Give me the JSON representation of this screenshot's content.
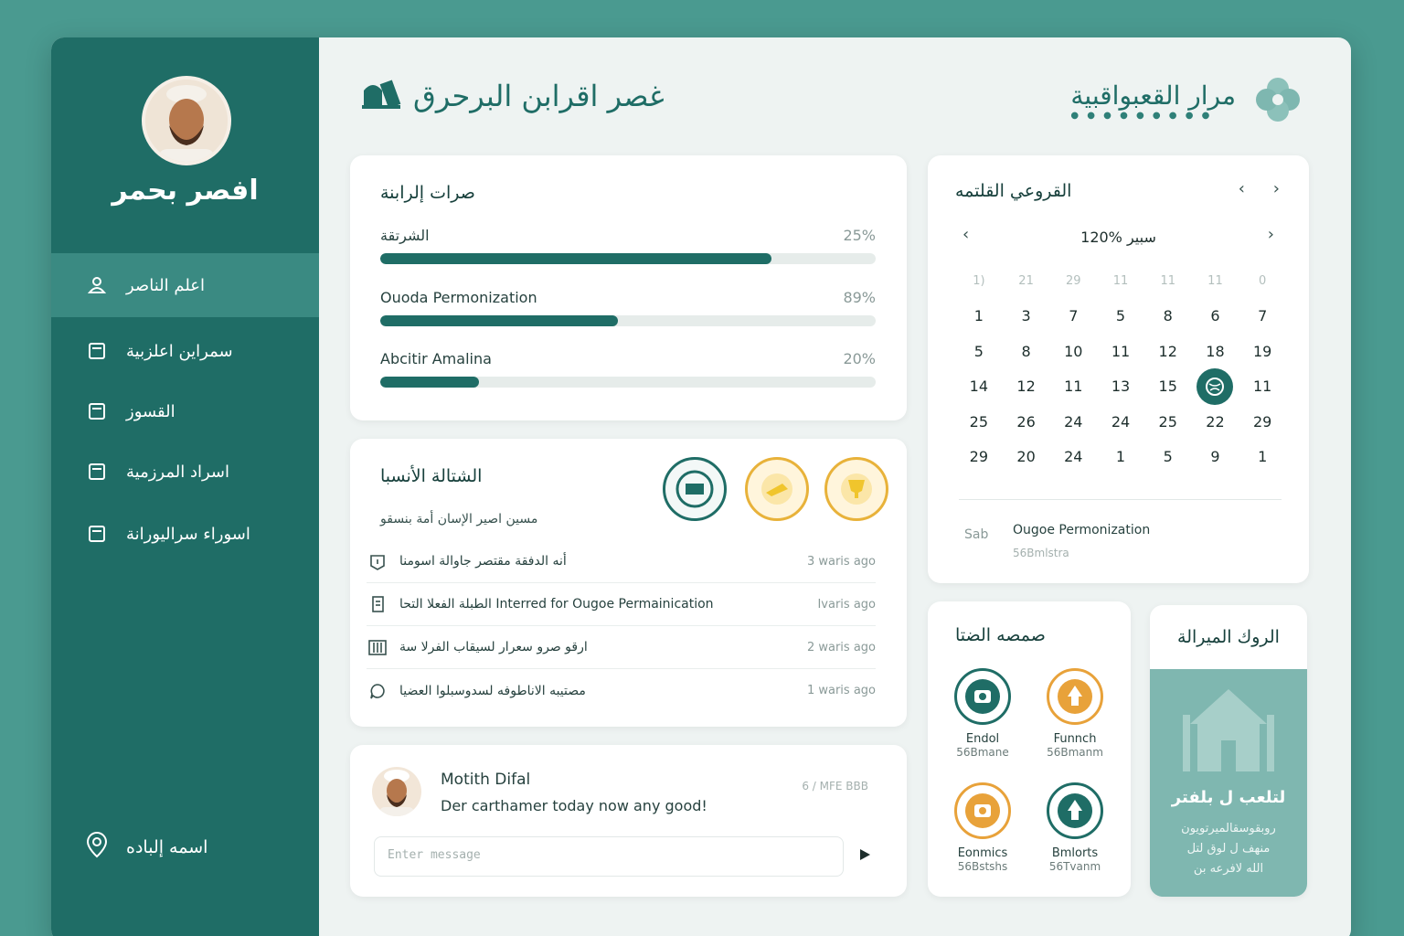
{
  "sidebar": {
    "user_name": "افصر بحمر",
    "items": [
      {
        "label": "اعلم الناصر",
        "icon": "user-icon"
      },
      {
        "label": "سمراين اعلزبية",
        "icon": "document-icon"
      },
      {
        "label": "القسوز",
        "icon": "document-icon"
      },
      {
        "label": "اسراد المرزمية",
        "icon": "document-icon"
      },
      {
        "label": "اسوراء سراليورانة",
        "icon": "document-icon"
      }
    ],
    "location_label": "اسمه إلباده"
  },
  "header": {
    "title": "غصر اقرابن البرحرق",
    "brand": "مرار القعبواقبية"
  },
  "progress_card": {
    "title": "صرات إلرابنة",
    "items": [
      {
        "label": "الشرتقة",
        "pct_label": "25%",
        "fill": 0.79
      },
      {
        "label": "Ouoda Permonization",
        "pct_label": "89%",
        "fill": 0.48
      },
      {
        "label": "Abcitir Amalina",
        "pct_label": "20%",
        "fill": 0.2
      }
    ]
  },
  "activity_card": {
    "title": "الشتالة الأنسبا",
    "subtitle": "مسين اصير الإسان أمة بنسقو",
    "rows": [
      {
        "text": "أنه الدفقة مقتصر جاوالة اسومنا",
        "time": "3 waris ago",
        "icon": "alert-icon"
      },
      {
        "text": "الطبلة الفعلا التحا Interred for Ougoe Permainication",
        "time": "Ivaris ago",
        "icon": "doc-icon"
      },
      {
        "text": "ارقو صرو سعرار لسيقاب الفرلا سة",
        "time": "2 waris ago",
        "icon": "building-icon"
      },
      {
        "text": "مصتيبه الاناطوفه لسدوسبلوا العضيا",
        "time": "1 waris ago",
        "icon": "chat-icon"
      }
    ]
  },
  "message_card": {
    "sender": "Motith Difal",
    "text": "Der carthamer today now any good!",
    "time": "6 / MFE BBB",
    "placeholder": "Enter message"
  },
  "calendar": {
    "title": "القروعي القلتمه",
    "month_label": "120% سبير",
    "weekdays": [
      "1)",
      "21",
      "29",
      "11",
      "11",
      "11",
      "0"
    ],
    "weeks": [
      [
        "1",
        "3",
        "7",
        "5",
        "8",
        "6",
        "7"
      ],
      [
        "5",
        "8",
        "10",
        "11",
        "12",
        "18",
        "19"
      ],
      [
        "14",
        "12",
        "11",
        "13",
        "15",
        "",
        "11"
      ],
      [
        "25",
        "26",
        "24",
        "24",
        "25",
        "22",
        "29"
      ],
      [
        "29",
        "20",
        "24",
        "1",
        "5",
        "9",
        "1"
      ]
    ],
    "event_tag": "Sab",
    "event_title": "Ougoe Permonization",
    "event_sub": "56Bmlstra"
  },
  "services": {
    "title": "صمصه الضتا",
    "items": [
      {
        "name": "Endol",
        "sub": "56Bmane",
        "color": "#1f6d66"
      },
      {
        "name": "Funnch",
        "sub": "56Bmanm",
        "color": "#e8a23a"
      },
      {
        "name": "Eonmics",
        "sub": "56Bstshs",
        "color": "#e8a23a"
      },
      {
        "name": "Bmlorts",
        "sub": "56Tvanm",
        "color": "#1f6d66"
      }
    ]
  },
  "promo": {
    "title": "الروك الميرالة",
    "headline": "لتلعب ل بلفتر",
    "lines": [
      "روبقوسقالميرتويون",
      "منهف ل لوق لتل",
      "الله لافرعه بن"
    ]
  }
}
